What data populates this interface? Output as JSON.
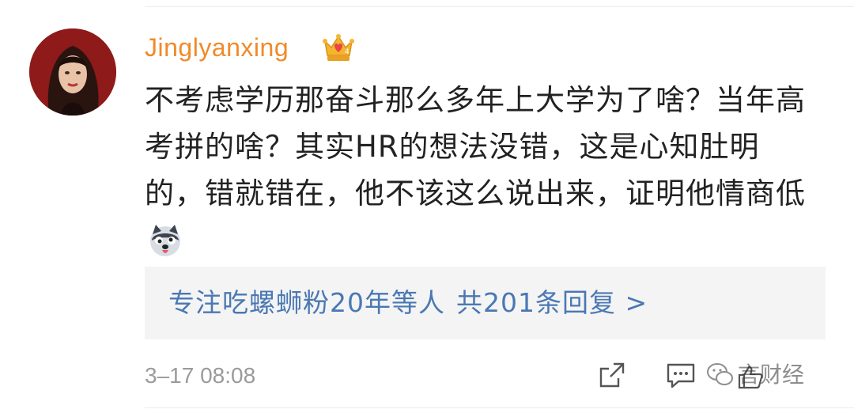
{
  "comment": {
    "username": "Jinglyanxing",
    "text": "不考虑学历那奋斗那么多年上大学为了啥？当年高考拼的啥？其实HR的想法没错，这是心知肚明的，错就错在，他不该这么说出来，证明他情商低",
    "timestamp": "3–17 08:08"
  },
  "replies": {
    "names": "专注吃螺蛳粉20年等人",
    "count": "共201条回复 >"
  },
  "watermark": {
    "text": "言财经"
  },
  "colors": {
    "username": "#f08a2a",
    "link": "#4a78b3",
    "text": "#222222",
    "meta": "#9a9a9a",
    "reply_bg": "#f4f4f4"
  },
  "icons": {
    "badge": "crown-icon",
    "emoji": "dog-icon",
    "share": "share-icon",
    "comment": "comment-icon",
    "like": "like-icon",
    "watermark_logo": "wechat-icon"
  }
}
